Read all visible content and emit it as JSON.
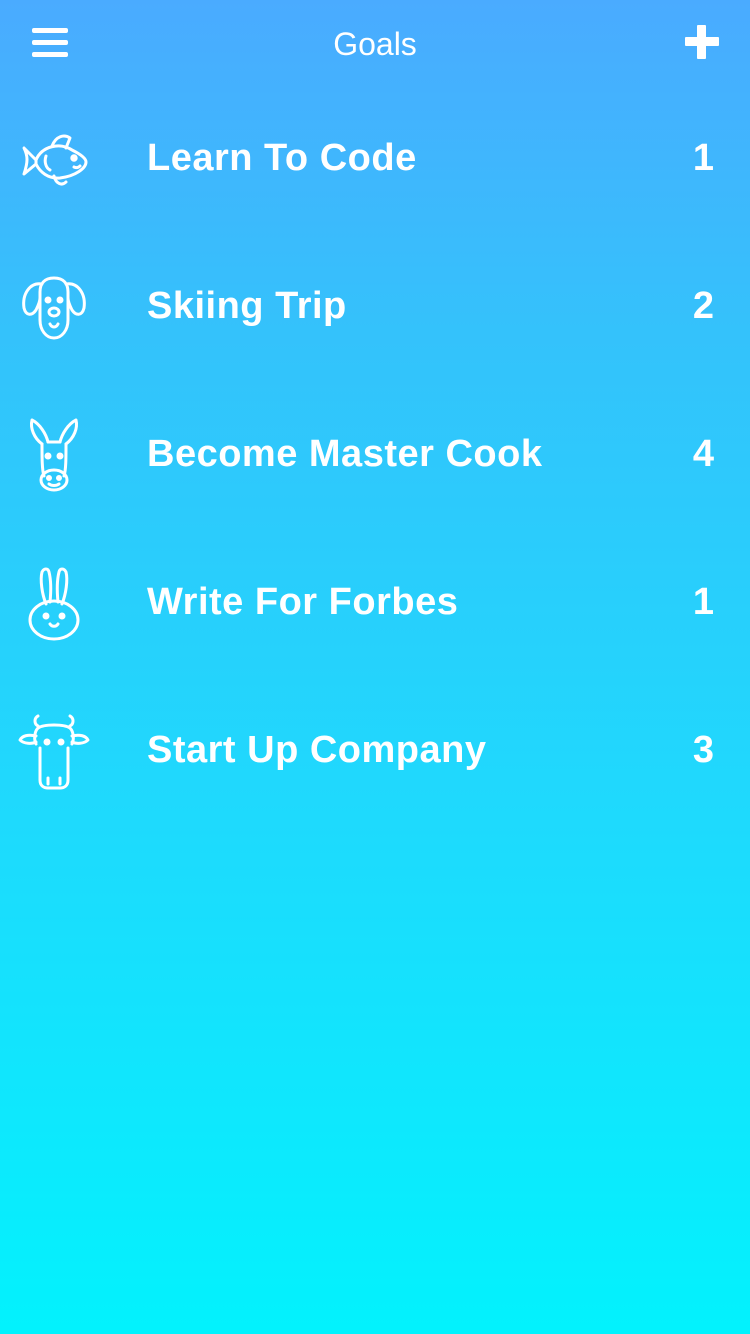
{
  "header": {
    "title": "Goals",
    "menu_icon": "hamburger-menu-icon",
    "add_icon": "plus-icon"
  },
  "goals": [
    {
      "icon": "fish-icon",
      "title": "Learn To Code",
      "count": "1"
    },
    {
      "icon": "dog-icon",
      "title": "Skiing Trip",
      "count": "2"
    },
    {
      "icon": "donkey-icon",
      "title": "Become Master Cook",
      "count": "4"
    },
    {
      "icon": "rabbit-icon",
      "title": "Write For Forbes",
      "count": "1"
    },
    {
      "icon": "cow-icon",
      "title": "Start Up Company",
      "count": "3"
    }
  ],
  "colors": {
    "gradient_top": "#4aabff",
    "gradient_bottom": "#02f2fd",
    "text": "#ffffff"
  }
}
